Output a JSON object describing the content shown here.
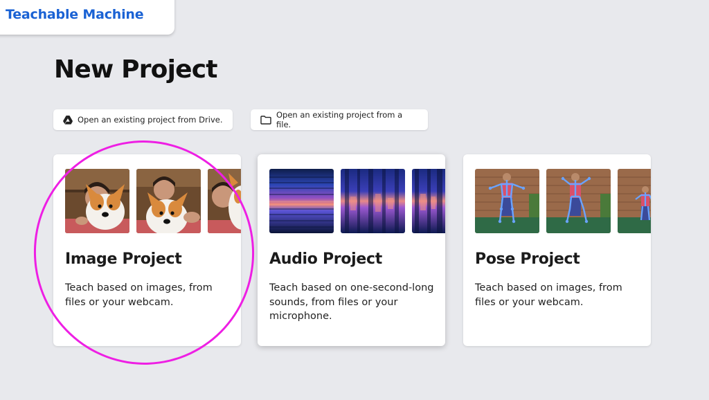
{
  "app": {
    "brand": "Teachable Machine"
  },
  "page": {
    "title": "New Project"
  },
  "actions": {
    "open_drive": {
      "label": "Open an existing project from Drive.",
      "icon": "google-drive-icon"
    },
    "open_file": {
      "label": "Open an existing project from a file.",
      "icon": "folder-icon"
    }
  },
  "projects": [
    {
      "title": "Image Project",
      "description": "Teach based on images, from files or your webcam."
    },
    {
      "title": "Audio Project",
      "description": "Teach based on one-second-long sounds, from files or your microphone."
    },
    {
      "title": "Pose Project",
      "description": "Teach based on images, from files or your webcam."
    }
  ],
  "colors": {
    "brand": "#1a62d4",
    "highlight": "#ee1fe4",
    "background": "#e8e9ed"
  }
}
